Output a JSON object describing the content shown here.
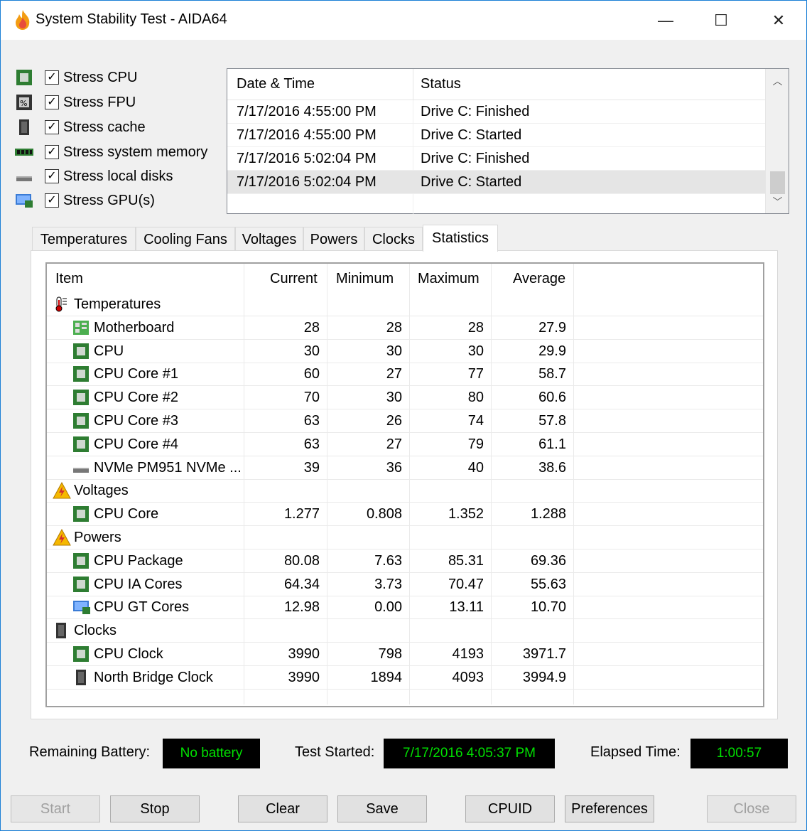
{
  "window": {
    "title": "System Stability Test - AIDA64",
    "min_label": "—",
    "max_label": "☐",
    "close_label": "✕"
  },
  "stress_options": [
    {
      "label": "Stress CPU",
      "checked": true,
      "icon": "cpu-chip-icon"
    },
    {
      "label": "Stress FPU",
      "checked": true,
      "icon": "fpu-chip-icon"
    },
    {
      "label": "Stress cache",
      "checked": true,
      "icon": "cache-chip-icon"
    },
    {
      "label": "Stress system memory",
      "checked": true,
      "icon": "memory-module-icon"
    },
    {
      "label": "Stress local disks",
      "checked": true,
      "icon": "disk-drive-icon"
    },
    {
      "label": "Stress GPU(s)",
      "checked": true,
      "icon": "gpu-monitor-icon"
    }
  ],
  "log": {
    "headers": [
      "Date & Time",
      "Status"
    ],
    "rows": [
      {
        "datetime": "7/17/2016 4:55:00 PM",
        "status": "Drive C: Finished"
      },
      {
        "datetime": "7/17/2016 4:55:00 PM",
        "status": "Drive C: Started"
      },
      {
        "datetime": "7/17/2016 5:02:04 PM",
        "status": "Drive C: Finished"
      },
      {
        "datetime": "7/17/2016 5:02:04 PM",
        "status": "Drive C: Started"
      }
    ],
    "selected_row": 3
  },
  "tabs": [
    "Temperatures",
    "Cooling Fans",
    "Voltages",
    "Powers",
    "Clocks",
    "Statistics"
  ],
  "active_tab": "Statistics",
  "stats": {
    "headers": [
      "Item",
      "Current",
      "Minimum",
      "Maximum",
      "Average"
    ],
    "rows": [
      {
        "type": "group",
        "label": "Temperatures",
        "icon": "thermometer-icon"
      },
      {
        "type": "item",
        "label": "Motherboard",
        "icon": "motherboard-icon",
        "current": "28",
        "minimum": "28",
        "maximum": "28",
        "average": "27.9"
      },
      {
        "type": "item",
        "label": "CPU",
        "icon": "cpu-chip-icon",
        "current": "30",
        "minimum": "30",
        "maximum": "30",
        "average": "29.9"
      },
      {
        "type": "item",
        "label": "CPU Core #1",
        "icon": "cpu-chip-icon",
        "current": "60",
        "minimum": "27",
        "maximum": "77",
        "average": "58.7"
      },
      {
        "type": "item",
        "label": "CPU Core #2",
        "icon": "cpu-chip-icon",
        "current": "70",
        "minimum": "30",
        "maximum": "80",
        "average": "60.6"
      },
      {
        "type": "item",
        "label": "CPU Core #3",
        "icon": "cpu-chip-icon",
        "current": "63",
        "minimum": "26",
        "maximum": "74",
        "average": "57.8"
      },
      {
        "type": "item",
        "label": "CPU Core #4",
        "icon": "cpu-chip-icon",
        "current": "63",
        "minimum": "27",
        "maximum": "79",
        "average": "61.1"
      },
      {
        "type": "item",
        "label": "NVMe PM951 NVMe ...",
        "icon": "disk-drive-icon",
        "current": "39",
        "minimum": "36",
        "maximum": "40",
        "average": "38.6"
      },
      {
        "type": "group",
        "label": "Voltages",
        "icon": "warning-voltage-icon"
      },
      {
        "type": "item",
        "label": "CPU Core",
        "icon": "cpu-chip-icon",
        "current": "1.277",
        "minimum": "0.808",
        "maximum": "1.352",
        "average": "1.288"
      },
      {
        "type": "group",
        "label": "Powers",
        "icon": "warning-power-icon"
      },
      {
        "type": "item",
        "label": "CPU Package",
        "icon": "cpu-chip-icon",
        "current": "80.08",
        "minimum": "7.63",
        "maximum": "85.31",
        "average": "69.36"
      },
      {
        "type": "item",
        "label": "CPU IA Cores",
        "icon": "cpu-chip-icon",
        "current": "64.34",
        "minimum": "3.73",
        "maximum": "70.47",
        "average": "55.63"
      },
      {
        "type": "item",
        "label": "CPU GT Cores",
        "icon": "gpu-monitor-icon",
        "current": "12.98",
        "minimum": "0.00",
        "maximum": "13.11",
        "average": "10.70"
      },
      {
        "type": "group",
        "label": "Clocks",
        "icon": "clock-chip-icon"
      },
      {
        "type": "item",
        "label": "CPU Clock",
        "icon": "cpu-chip-icon",
        "current": "3990",
        "minimum": "798",
        "maximum": "4193",
        "average": "3971.7"
      },
      {
        "type": "item",
        "label": "North Bridge Clock",
        "icon": "northbridge-chip-icon",
        "current": "3990",
        "minimum": "1894",
        "maximum": "4093",
        "average": "3994.9"
      }
    ]
  },
  "status": {
    "battery_label": "Remaining Battery:",
    "battery_value": "No battery",
    "started_label": "Test Started:",
    "started_value": "7/17/2016 4:05:37 PM",
    "elapsed_label": "Elapsed Time:",
    "elapsed_value": "1:00:57"
  },
  "buttons": {
    "start": "Start",
    "stop": "Stop",
    "clear": "Clear",
    "save": "Save",
    "cpuid": "CPUID",
    "preferences": "Preferences",
    "close": "Close"
  },
  "colors": {
    "accent_border": "#1b7fd6",
    "status_text_green": "#00e000",
    "status_bg": "#000000",
    "chip_green": "#2e7d32"
  }
}
